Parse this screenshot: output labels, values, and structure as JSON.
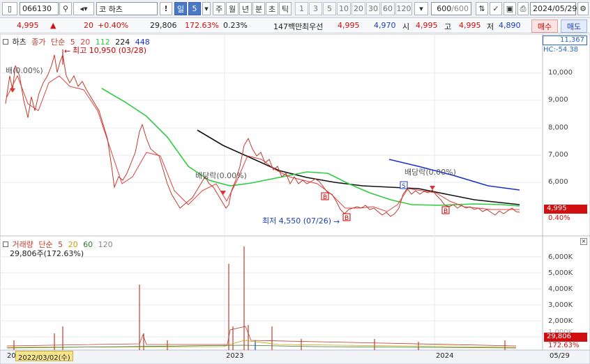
{
  "toolbar": {
    "code": "066130",
    "market": "코",
    "name": "하츠",
    "period_selected": "일",
    "period_n": "5",
    "period_tabs": [
      "주",
      "월",
      "년",
      "분",
      "초",
      "틱"
    ],
    "num_tabs": [
      "1",
      "3",
      "5",
      "10",
      "20",
      "30",
      "60",
      "120"
    ],
    "count": "600",
    "count_total": "/600",
    "date": "2024/05/29"
  },
  "quote": {
    "price": "4,995",
    "change": "20",
    "change_pct": "+0.40%",
    "volume": "29,806",
    "vol_ratio": "172.63%",
    "turnover": "0.23%",
    "amount": "147백만",
    "best_ask_label": "최우선",
    "best_ask": "4,995",
    "best_bid": "4,970",
    "open_label": "시",
    "open": "4,995",
    "high_label": "고",
    "high": "4,995",
    "low_label": "저",
    "low": "4,890",
    "buy": "매수",
    "sell": "매도"
  },
  "price_panel": {
    "tab": "하츠",
    "legend": [
      "종가",
      "단순",
      "5",
      "20",
      "112",
      "224",
      "448"
    ],
    "legend_colors": [
      "#c0392b",
      "#c0392b",
      "#c0392b",
      "#e04040",
      "#2ecc40",
      "#111111",
      "#1a2fd0"
    ],
    "high_label": "최고 10,950 (03/28)",
    "low_label": "최저 4,550 (07/26)",
    "left_cut_label": "배(0.00%)",
    "div1": "배당락(0.00%)",
    "div2": "배당락(0.00%)",
    "marker_s": "S",
    "marker_b": "B",
    "axis": [
      "10,000",
      "9,000",
      "8,000",
      "7,000",
      "6,000"
    ],
    "top_box": "11,367",
    "hc_label": "HC:-54.38",
    "price_box": "4,995",
    "pct_label": "0.40%"
  },
  "volume_panel": {
    "legend": [
      "거래량",
      "단순",
      "5",
      "20",
      "60",
      "120"
    ],
    "legend_colors": [
      "#c0392b",
      "#c0392b",
      "#c0392b",
      "#c8a000",
      "#2c7a2c",
      "#888888"
    ],
    "sub": "29,806주(172.63%)",
    "axis": [
      "6,000K",
      "5,000K",
      "4,000K",
      "3,000K",
      "2,000K",
      "1,000K"
    ],
    "vol_box": "29,806",
    "vol_pct": "172.63%"
  },
  "xaxis": {
    "left": "20",
    "cursor": "2022/03/02(수)",
    "y2023": "2023",
    "y2024": "2024",
    "right": "05/29"
  }
}
